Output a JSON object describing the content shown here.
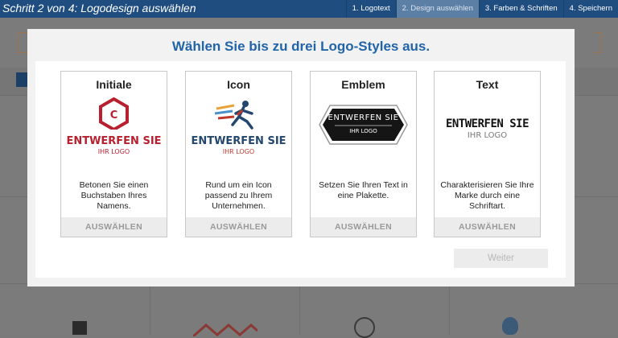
{
  "header": {
    "title": "Schritt 2 von 4: Logodesign auswählen",
    "steps": [
      "1. Logotext",
      "2. Design auswählen",
      "3. Farben & Schriften",
      "4. Speichern"
    ],
    "active_step": 1
  },
  "modal": {
    "heading": "Wählen Sie bis zu drei Logo-Styles aus.",
    "cards": [
      {
        "title": "Initiale",
        "logo": {
          "monogram": "C",
          "line1": "ENTWERFEN SIE",
          "line2": "IHR LOGO"
        },
        "description": "Betonen Sie einen Buchstaben Ihres Namens.",
        "button": "AUSWÄHLEN"
      },
      {
        "title": "Icon",
        "logo": {
          "line1": "ENTWERFEN SIE",
          "line2": "IHR LOGO",
          "icon": "runner-icon"
        },
        "description": "Rund um ein Icon passend zu Ihrem Unternehmen.",
        "button": "AUSWÄHLEN"
      },
      {
        "title": "Emblem",
        "logo": {
          "line1": "ENTWERFEN SIE",
          "line2": "IHR LOGO"
        },
        "description": "Setzen Sie Ihren Text in eine Plakette.",
        "button": "AUSWÄHLEN"
      },
      {
        "title": "Text",
        "logo": {
          "line1": "ENTWERFEN SIE",
          "line2": "IHR LOGO"
        },
        "description": "Charakterisieren Sie Ihre Marke durch eine Schriftart.",
        "button": "AUSWÄHLEN"
      }
    ],
    "continue_button": "Weiter"
  },
  "colors": {
    "header_bg": "#1f4d80",
    "heading": "#2164a8",
    "monogram_red": "#b8202f",
    "icon_blue": "#24476e",
    "icon_red": "#c0392b"
  }
}
